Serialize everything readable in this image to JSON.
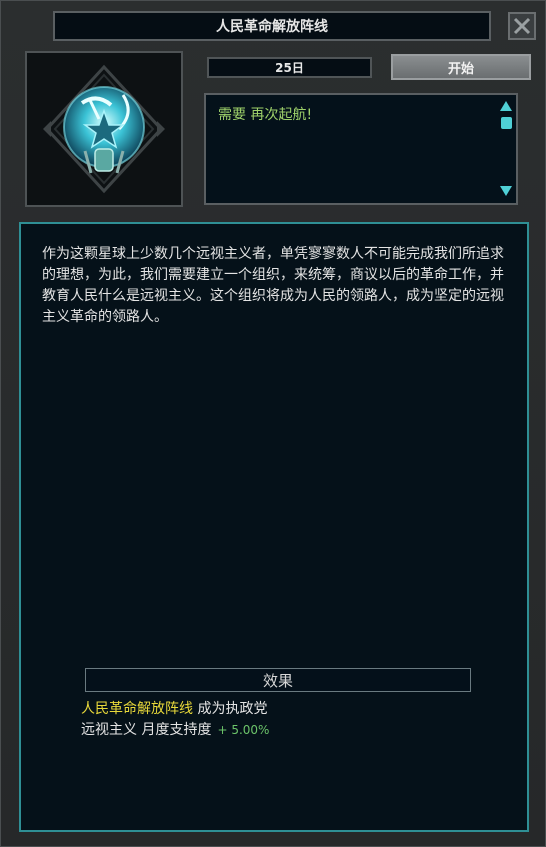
{
  "window": {
    "title": "人民革命解放阵线",
    "close_icon": "close-icon"
  },
  "header": {
    "date": "25日",
    "start_label": "开始"
  },
  "requirement": {
    "text": "需要 再次起航!"
  },
  "description": "作为这颗星球上少数几个远视主义者，单凭寥寥数人不可能完成我们所追求的理想，为此，我们需要建立一个组织，来统筹，商议以后的革命工作，并教育人民什么是远视主义。这个组织将成为人民的领路人，成为坚定的远视主义革命的领路人。",
  "effects": {
    "header": "效果",
    "line1_highlight": "人民革命解放阵线",
    "line1_rest": " 成为执政党",
    "line2_text": "远视主义 月度支持度",
    "line2_value": "+ 5.00%"
  },
  "colors": {
    "accent": "#2f8f95",
    "requirement": "#9fd26b",
    "highlight": "#e8d83a",
    "positive": "#6cc46a"
  }
}
